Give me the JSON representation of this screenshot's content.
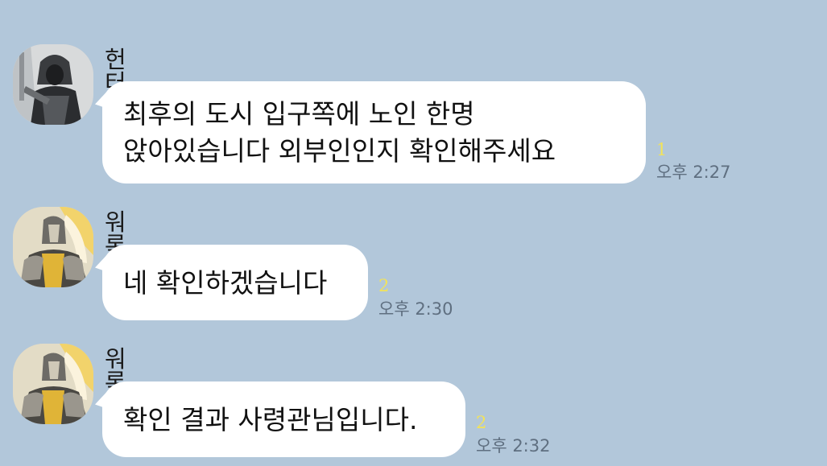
{
  "colors": {
    "background": "#b2c7da",
    "bubble": "#ffffff",
    "unread": "#f2e35a",
    "time": "#5f6f80"
  },
  "messages": [
    {
      "sender": "헌터",
      "avatar_icon": "hooded-hunter-avatar",
      "lines": [
        "최후의 도시 입구쪽에 노인 한명",
        "앉아있습니다 외부인인지 확인해주세요"
      ],
      "unread": "1",
      "time": "오후 2:27"
    },
    {
      "sender": "워록",
      "avatar_icon": "warlock-armor-avatar",
      "lines": [
        "네 확인하겠습니다"
      ],
      "unread": "2",
      "time": "오후 2:30"
    },
    {
      "sender": "워록",
      "avatar_icon": "warlock-armor-avatar",
      "lines": [
        "확인 결과 사령관님입니다."
      ],
      "unread": "2",
      "time": "오후 2:32"
    }
  ]
}
